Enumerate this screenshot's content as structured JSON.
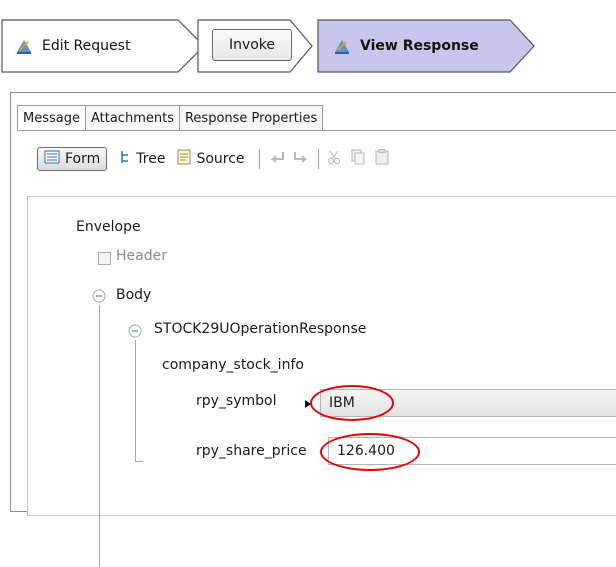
{
  "wizard": {
    "steps": [
      {
        "label": "Edit Request",
        "icon": "edit-request-icon"
      },
      {
        "label": "Invoke"
      },
      {
        "label": "View Response",
        "icon": "view-response-icon"
      }
    ]
  },
  "tabs": [
    {
      "label": "Message",
      "active": true
    },
    {
      "label": "Attachments"
    },
    {
      "label": "Response Properties"
    }
  ],
  "toolbar": {
    "form_label": "Form",
    "tree_label": "Tree",
    "source_label": "Source"
  },
  "tree": {
    "envelope": "Envelope",
    "header": "Header",
    "body": "Body",
    "operation": "STOCK29UOperationResponse",
    "group": "company_stock_info",
    "fields": [
      {
        "label": "rpy_symbol",
        "value": "IBM"
      },
      {
        "label": "rpy_share_price",
        "value": "126.400"
      }
    ]
  },
  "colors": {
    "active_step": "#c9c6ee",
    "highlight": "#e00000"
  }
}
